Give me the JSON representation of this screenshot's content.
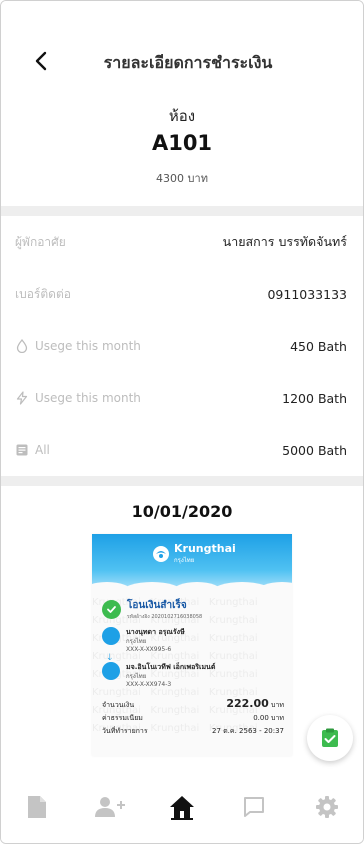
{
  "header": {
    "title": "รายละเอียดการชำระเงิน",
    "room_label": "ห้อง",
    "room_no": "A101",
    "room_price": "4300 บาท"
  },
  "info": [
    {
      "label": "ผู้พักอาศัย",
      "value": "นายสการ บรรทัดจันทร์",
      "icon": ""
    },
    {
      "label": "เบอร์ติดต่อ",
      "value": "0911033133",
      "icon": ""
    },
    {
      "label": "Usege this month",
      "value": "450 Bath",
      "icon": "water-drop-icon"
    },
    {
      "label": "Usege this month",
      "value": "1200 Bath",
      "icon": "lightning-icon"
    },
    {
      "label": "All",
      "value": "5000 Bath",
      "icon": "receipt-icon"
    }
  ],
  "slip": {
    "date": "10/01/2020",
    "bank_name": "Krungthai",
    "bank_sub": "กรุงไทย",
    "status": "โอนเงินสำเร็จ",
    "ref": "รหัสอ้างอิง 2020102716038058",
    "watermark": "Krungthai",
    "sender_name": "นางนุทดา อรุณรังษี",
    "sender_bank": "กรุงไทย",
    "sender_acct": "XXX-X-XX995-6",
    "receiver_name": "มจ.อินโนเวทีฟ เอ็กเพอริเมนต์",
    "receiver_bank": "กรุงไทย",
    "receiver_acct": "XXX-X-XX974-3",
    "amount_label": "จำนวนเงิน",
    "amount": "222.00",
    "amount_unit": "บาท",
    "fee_label": "ค่าธรรมเนียม",
    "fee": "0.00 บาท",
    "date_label": "วันที่ทำรายการ",
    "datetime": "27 ต.ค. 2563 - 20:37"
  },
  "colors": {
    "accent": "#1ea0e6",
    "success": "#3dbb4f",
    "nav_active": "#111111",
    "nav_inactive": "#c4c4c4"
  },
  "nav": [
    "document-icon",
    "add-user-icon",
    "home-icon",
    "chat-icon",
    "settings-icon"
  ]
}
